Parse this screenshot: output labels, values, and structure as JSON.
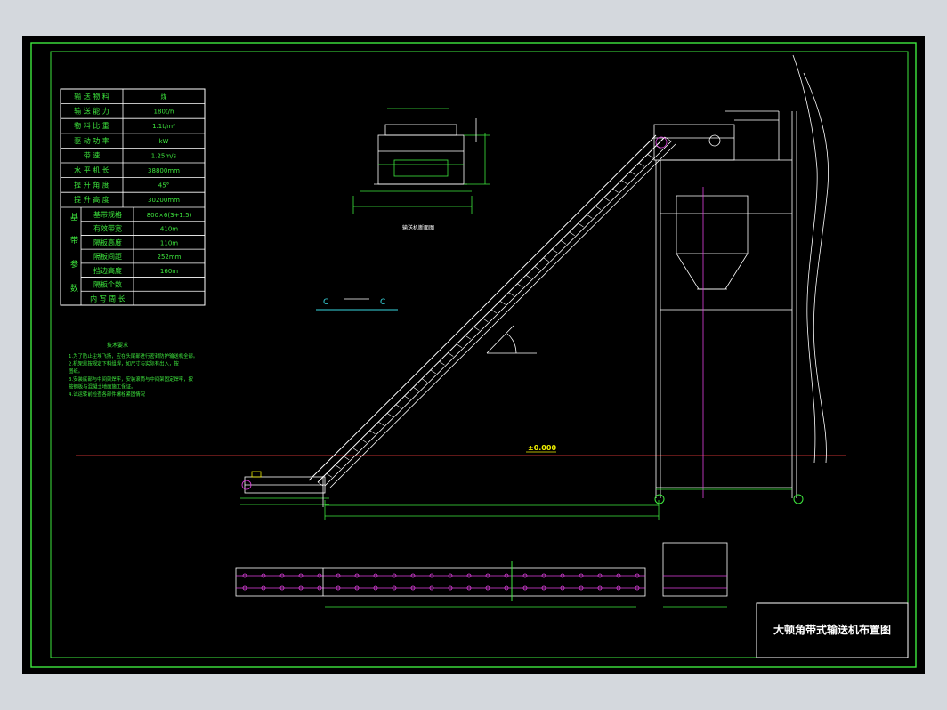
{
  "drawing": {
    "title": "大顿角带式输送机布置图",
    "section_marker": {
      "left": "C",
      "right": "C"
    },
    "elevation_label": "±0.000",
    "side_view_label": "输送机断面图",
    "param_table": {
      "rows": [
        {
          "label": "输 送 物 料",
          "value": "煤"
        },
        {
          "label": "输 送 能 力",
          "value": "180t/h"
        },
        {
          "label": "物 料 比 重",
          "value": "1.1t/m³"
        },
        {
          "label": "驱 动 功 率",
          "value": "kW"
        },
        {
          "label": "带 速",
          "value": "1.25m/s"
        },
        {
          "label": "水 平 机 长",
          "value": "38800mm"
        },
        {
          "label": "提 升 角 度",
          "value": "45°"
        },
        {
          "label": "提 升 高 度",
          "value": "30200mm"
        }
      ],
      "group_label": "基 带 参 数",
      "group_rows": [
        {
          "label": "基带规格",
          "value": "800×6(3+1.5)"
        },
        {
          "label": "有效带宽",
          "value": "410m"
        },
        {
          "label": "隔板高度",
          "value": "110m"
        },
        {
          "label": "隔板间距",
          "value": "252mm"
        },
        {
          "label": "挡边高度",
          "value": "160m"
        },
        {
          "label": "隔板个数",
          "value": ""
        },
        {
          "label": "内 写 周 长",
          "value": ""
        }
      ]
    },
    "notes": {
      "heading": "技术要求",
      "lines": [
        "1.为了防止尘埃飞扬，应在头尾部进行密封防护输送机全部。",
        "2.机架是按规定下料组焊，如尺寸与实际有出入，按",
        "   图纸。",
        "3.安装底部与中间架焊牢，安装滚筒与中间架固定焊牢，按",
        "   按钢板与混凝土地面施工保证。",
        "4.试运转前检查各部件螺栓紧固情况"
      ]
    }
  },
  "colors": {
    "background": "#000000",
    "frame": "#3ee83e",
    "structure": "#ffffff",
    "ground_line": "#c03030",
    "accent": "#f0f000",
    "cyan": "#39d8e0",
    "magenta": "#e040e0"
  }
}
